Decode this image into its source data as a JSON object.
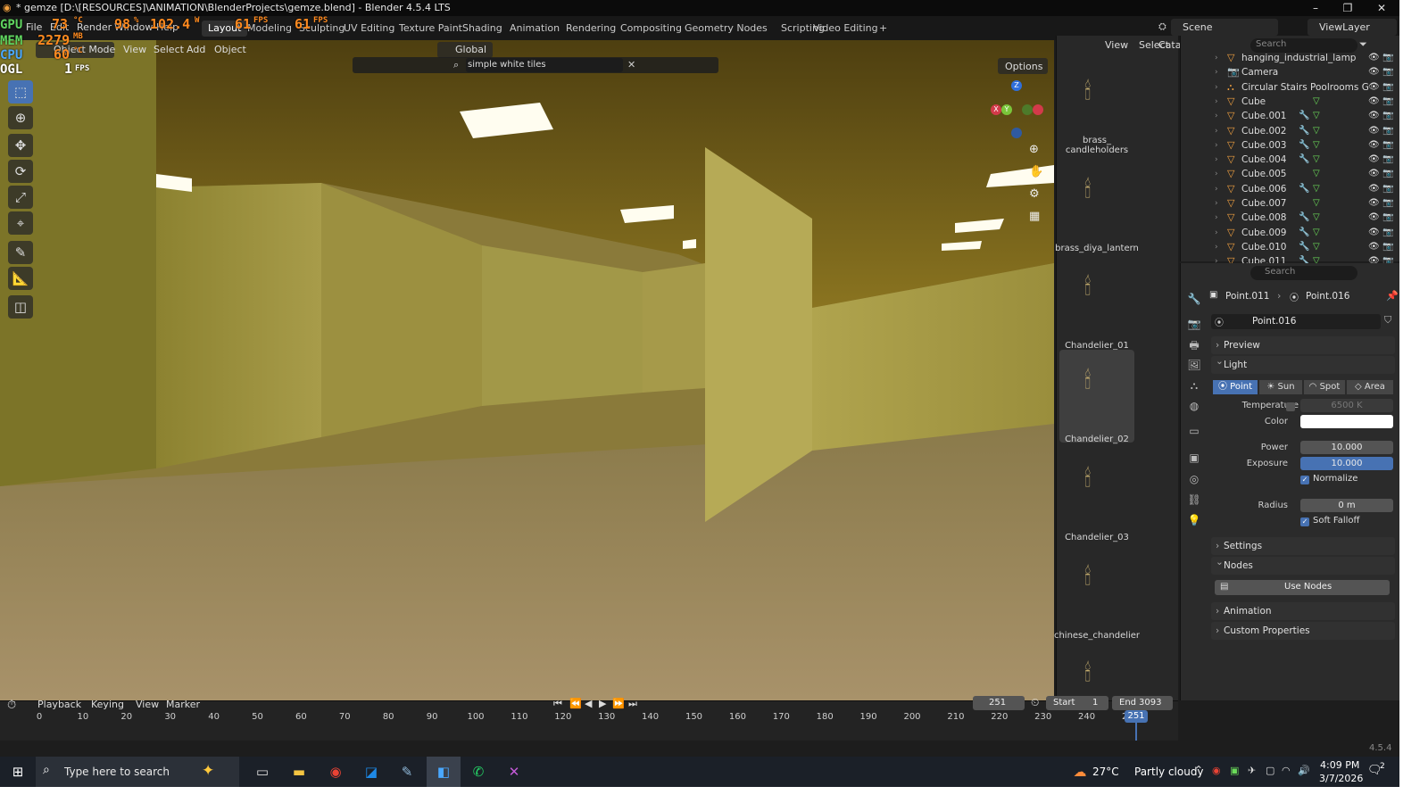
{
  "window": {
    "title": "* gemze [D:\\[RESOURCES]\\ANIMATION\\BlenderProjects\\gemze.blend] - Blender 4.5.4 LTS",
    "minimize": "–",
    "restore": "❐",
    "close": "✕"
  },
  "menu": {
    "file": "File",
    "edit": "Edit",
    "render": "Render",
    "window": "Window",
    "help": "Help"
  },
  "workspaces": [
    "Layout",
    "Modeling",
    "Sculpting",
    "UV Editing",
    "Texture Paint",
    "Shading",
    "Animation",
    "Rendering",
    "Compositing",
    "Geometry Nodes",
    "Scripting",
    "Video Editing",
    "+"
  ],
  "scene": {
    "label": "Scene",
    "viewlayer": "ViewLayer"
  },
  "hud": {
    "gpu_label": "GPU",
    "gpu_temp": "73",
    "gpu_unit": "°C",
    "gpu_load": "98",
    "gpu_load_unit": "%",
    "gpu_power": "102.4",
    "gpu_power_unit": "W",
    "fps": "61",
    "fps_unit": "FPS",
    "fps2": "61",
    "fps2_unit": "FPS",
    "mem_label": "MEM",
    "mem_val": "2279",
    "mem_unit": "MB",
    "cpu_label": "CPU",
    "cpu_temp": "60",
    "cpu_unit": "°C",
    "ogl_label": "OGL",
    "ogl_fps": "1",
    "ogl_unit": "FPS"
  },
  "viewport_header": {
    "mode": "Object Mode",
    "view": "View",
    "select": "Select",
    "add": "Add",
    "object": "Object",
    "orientation": "Global",
    "search_value": "simple white tiles",
    "options": "Options"
  },
  "asset_browser": {
    "view": "View",
    "select": "Select",
    "catalog": "Cata",
    "assets": [
      {
        "name": "brass_\ncandleholders"
      },
      {
        "name": "brass_diya_lantern"
      },
      {
        "name": "Chandelier_01"
      },
      {
        "name": "Chandelier_02",
        "selected": true
      },
      {
        "name": "Chandelier_03"
      },
      {
        "name": "chinese_chandelier"
      },
      {
        "name": ""
      }
    ]
  },
  "outliner": {
    "search_placeholder": "Search",
    "rows": [
      {
        "name": "hanging_industrial_lamp",
        "mod": false,
        "mesh": false
      },
      {
        "name": "Camera",
        "mod": false,
        "mesh": false
      },
      {
        "name": "Circular Stairs Poolrooms G",
        "mod": false,
        "mesh": false
      },
      {
        "name": "Cube",
        "mod": false,
        "mesh": true
      },
      {
        "name": "Cube.001",
        "mod": true,
        "mesh": true
      },
      {
        "name": "Cube.002",
        "mod": true,
        "mesh": true
      },
      {
        "name": "Cube.003",
        "mod": true,
        "mesh": true
      },
      {
        "name": "Cube.004",
        "mod": true,
        "mesh": true
      },
      {
        "name": "Cube.005",
        "mod": false,
        "mesh": true
      },
      {
        "name": "Cube.006",
        "mod": true,
        "mesh": true
      },
      {
        "name": "Cube.007",
        "mod": false,
        "mesh": true
      },
      {
        "name": "Cube.008",
        "mod": true,
        "mesh": true
      },
      {
        "name": "Cube.009",
        "mod": true,
        "mesh": true
      },
      {
        "name": "Cube.010",
        "mod": true,
        "mesh": true
      },
      {
        "name": "Cube.011",
        "mod": true,
        "mesh": true
      }
    ]
  },
  "properties": {
    "search_placeholder": "Search",
    "breadcrumb_object": "Point.011",
    "breadcrumb_data": "Point.016",
    "datablock": "Point.016",
    "panels": {
      "preview": "Preview",
      "light": "Light",
      "settings": "Settings",
      "nodes": "Nodes",
      "animation": "Animation",
      "custom_properties": "Custom Properties"
    },
    "light_types": [
      "Point",
      "Sun",
      "Spot",
      "Area"
    ],
    "active_light_type": "Point",
    "temperature_label": "Temperature",
    "temperature_value": "6500 K",
    "color_label": "Color",
    "color_value": "#ffffff",
    "power_label": "Power",
    "power_value": "10.000",
    "exposure_label": "Exposure",
    "exposure_value": "10.000",
    "normalize_label": "Normalize",
    "radius_label": "Radius",
    "radius_value": "0 m",
    "soft_falloff_label": "Soft Falloff",
    "use_nodes": "Use Nodes"
  },
  "timeline": {
    "playback": "Playback",
    "keying": "Keying",
    "view": "View",
    "marker": "Marker",
    "current_frame": "251",
    "start_label": "Start",
    "start_value": "1",
    "end_label": "End",
    "end_value": "3093",
    "ticks": [
      "0",
      "10",
      "20",
      "30",
      "40",
      "50",
      "60",
      "70",
      "80",
      "90",
      "100",
      "110",
      "120",
      "130",
      "140",
      "150",
      "160",
      "170",
      "180",
      "190",
      "200",
      "210",
      "220",
      "230",
      "240",
      "250"
    ],
    "playhead": "251"
  },
  "status": {
    "version": "4.5.4"
  },
  "taskbar": {
    "search_placeholder": "Type here to search",
    "weather_temp": "27°C",
    "weather_desc": "Partly cloudy",
    "time": "4:09 PM",
    "date": "3/7/2026",
    "notification_count": "2"
  },
  "colors": {
    "accent": "#4772b3",
    "hud_orange": "#ff8a1f"
  }
}
